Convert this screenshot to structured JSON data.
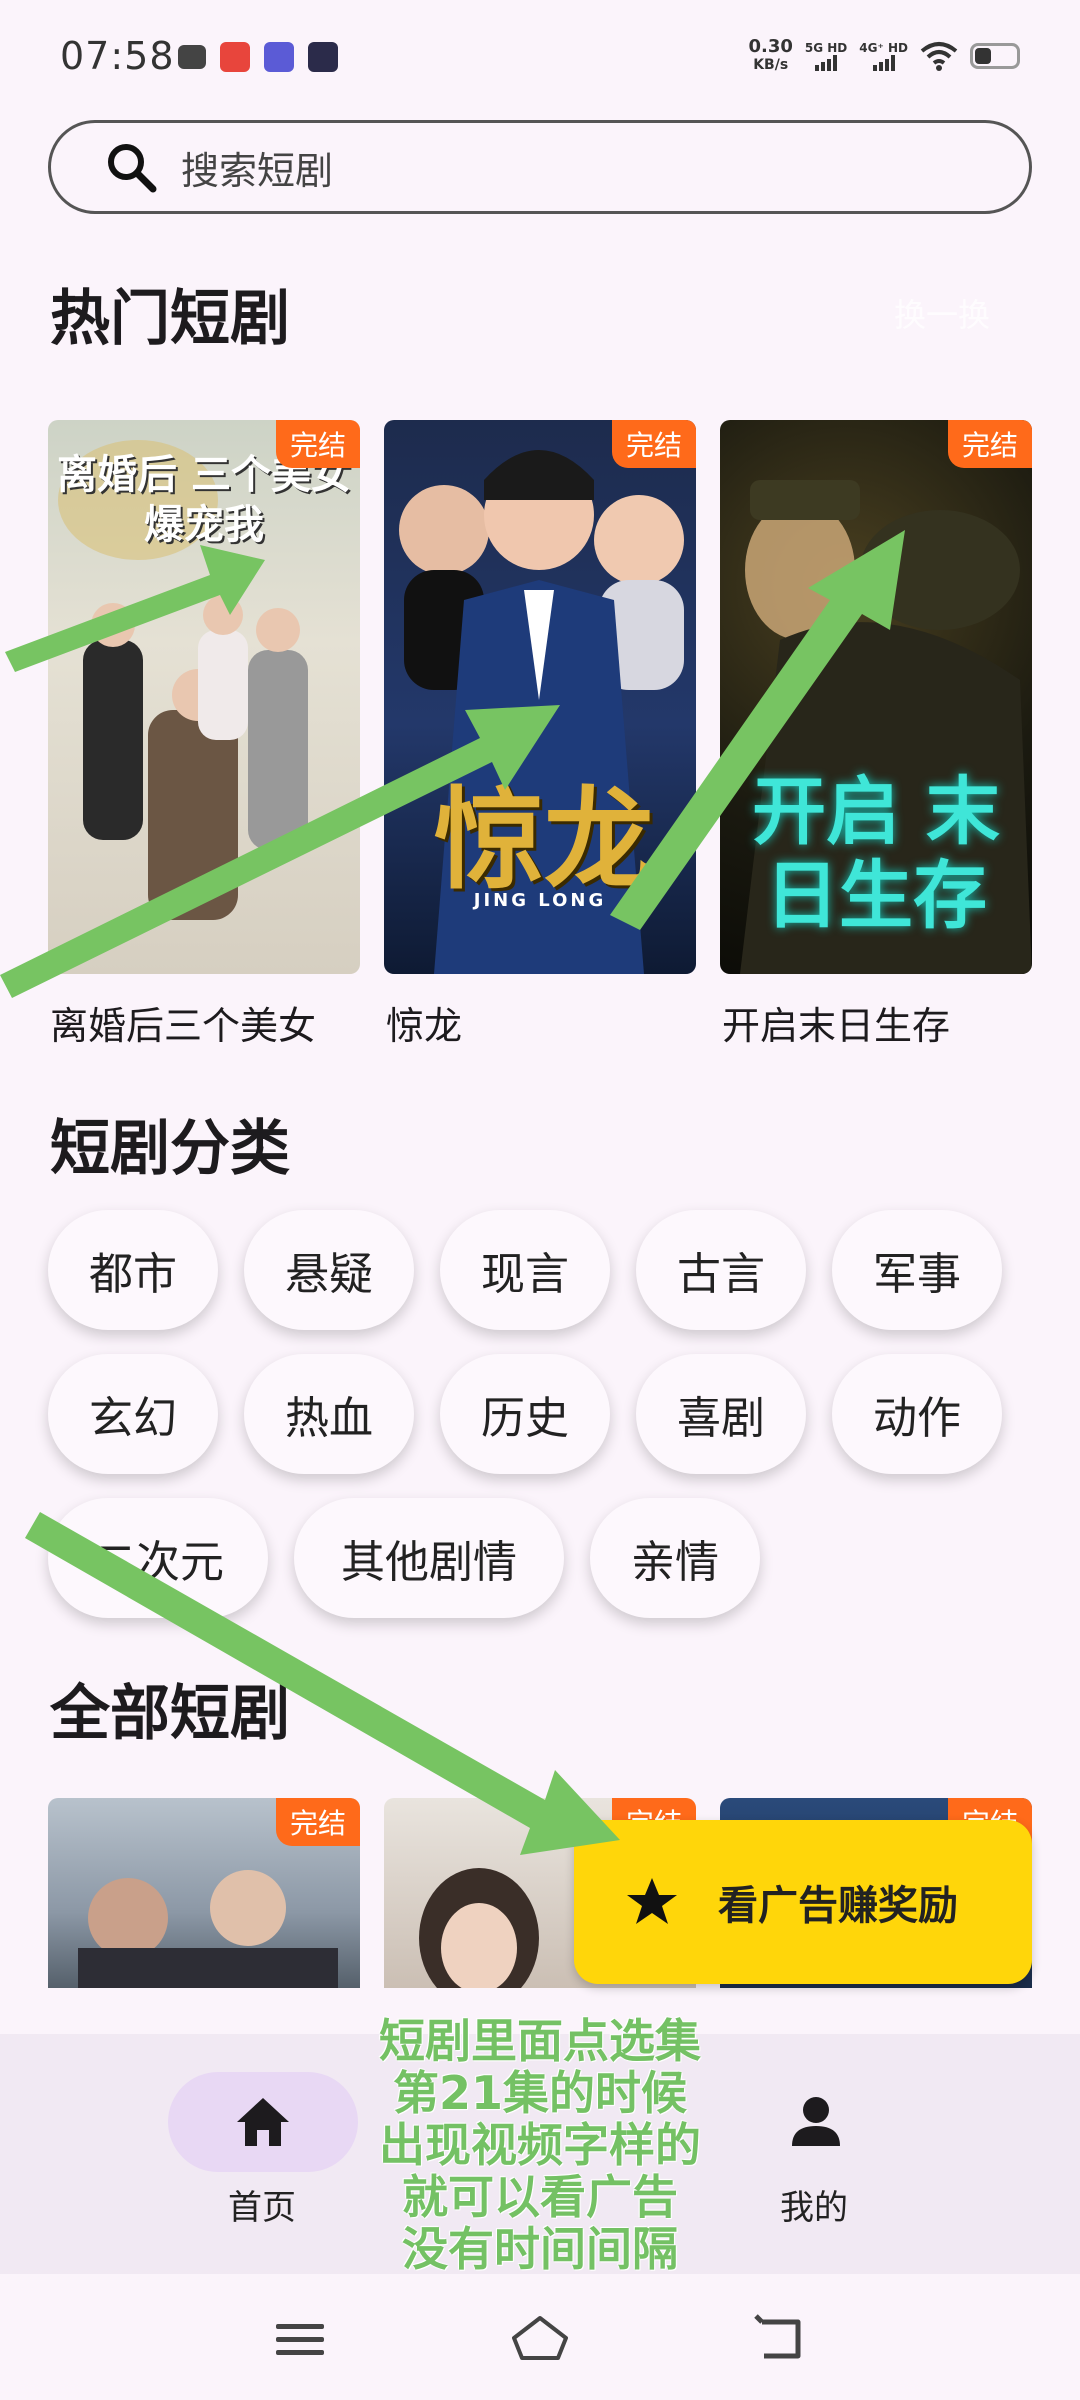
{
  "status": {
    "time": "07:58",
    "net_speed_value": "0.30",
    "net_speed_unit": "KB/s",
    "sim1": "5G HD",
    "sim2": "4G⁺ HD"
  },
  "search": {
    "placeholder": "搜索短剧"
  },
  "hot": {
    "title": "热门短剧",
    "change_label": "换一换",
    "items": [
      {
        "title": "离婚后三个美女",
        "badge": "完结",
        "poster_text": "离婚后 三个美女爆宠我"
      },
      {
        "title": "惊龙",
        "badge": "完结",
        "poster_text": "惊龙",
        "poster_sub": "JING LONG"
      },
      {
        "title": "开启末日生存",
        "badge": "完结",
        "poster_text": "开启 末日生存"
      }
    ]
  },
  "categories": {
    "title": "短剧分类",
    "items": [
      "都市",
      "悬疑",
      "现言",
      "古言",
      "军事",
      "玄幻",
      "热血",
      "历史",
      "喜剧",
      "动作",
      "二次元",
      "其他剧情",
      "亲情"
    ]
  },
  "all": {
    "title": "全部短剧",
    "badges": [
      "完结",
      "完结",
      "完结"
    ]
  },
  "reward_button": {
    "label": "看广告赚奖励",
    "icon": "star-icon"
  },
  "nav": {
    "home_label": "首页",
    "mine_label": "我的"
  },
  "annotation": {
    "lines": [
      "短剧里面点选集",
      "第21集的时候",
      "出现视频字样的",
      "就可以看广告",
      "没有时间间隔"
    ]
  },
  "colors": {
    "background": "#fbf4fb",
    "badge": "#ff6a1a",
    "reward": "#ffd60a",
    "annotation_green": "#74c164",
    "nav_active": "#e8d8f4"
  }
}
